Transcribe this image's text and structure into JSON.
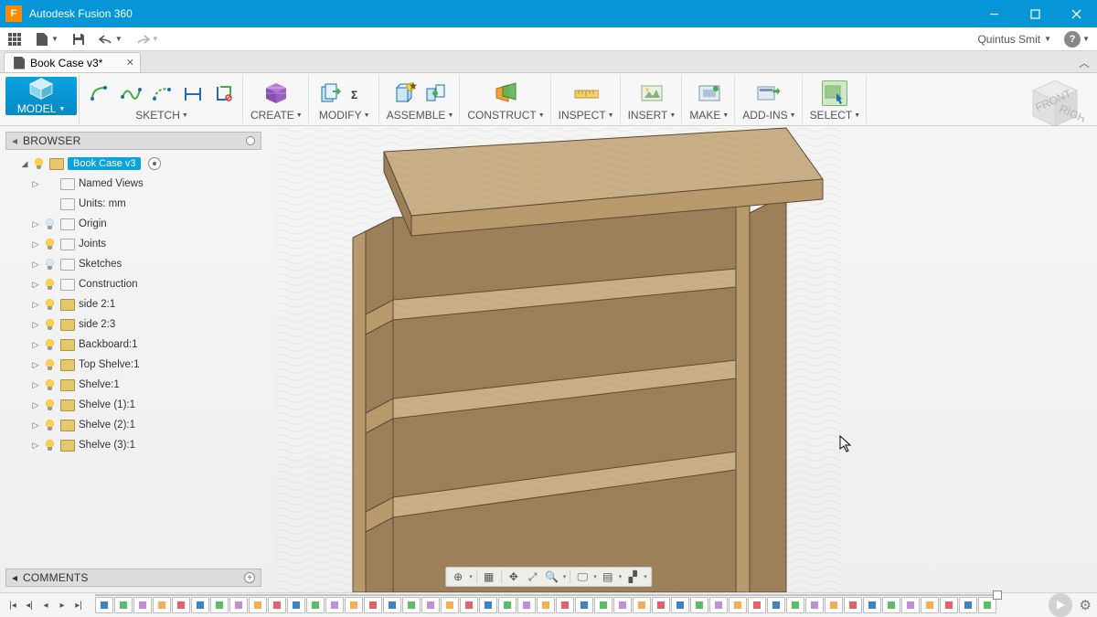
{
  "app": {
    "title": "Autodesk Fusion 360",
    "logo_letter": "F"
  },
  "user": {
    "name": "Quintus Smit"
  },
  "document": {
    "tab_title": "Book Case v3*"
  },
  "ribbon": {
    "model": "MODEL",
    "groups": {
      "sketch": "SKETCH",
      "create": "CREATE",
      "modify": "MODIFY",
      "assemble": "ASSEMBLE",
      "construct": "CONSTRUCT",
      "inspect": "INSPECT",
      "insert": "INSERT",
      "make": "MAKE",
      "addins": "ADD-INS",
      "select": "SELECT"
    }
  },
  "browser": {
    "header": "BROWSER",
    "root": "Book Case v3",
    "items": [
      {
        "label": "Named Views",
        "bulb": "none",
        "icon": "folder"
      },
      {
        "label": "Units: mm",
        "bulb": "none",
        "icon": "folder",
        "expandable": false
      },
      {
        "label": "Origin",
        "bulb": "off",
        "icon": "folder"
      },
      {
        "label": "Joints",
        "bulb": "on",
        "icon": "folder"
      },
      {
        "label": "Sketches",
        "bulb": "off",
        "icon": "folder"
      },
      {
        "label": "Construction",
        "bulb": "on",
        "icon": "folder"
      },
      {
        "label": "side 2:1",
        "bulb": "on",
        "icon": "comp"
      },
      {
        "label": "side 2:3",
        "bulb": "on",
        "icon": "comp"
      },
      {
        "label": "Backboard:1",
        "bulb": "on",
        "icon": "comp"
      },
      {
        "label": "Top Shelve:1",
        "bulb": "on",
        "icon": "comp"
      },
      {
        "label": "Shelve:1",
        "bulb": "on",
        "icon": "comp"
      },
      {
        "label": "Shelve (1):1",
        "bulb": "on",
        "icon": "comp"
      },
      {
        "label": "Shelve (2):1",
        "bulb": "on",
        "icon": "comp"
      },
      {
        "label": "Shelve (3):1",
        "bulb": "on",
        "icon": "comp"
      }
    ]
  },
  "comments": {
    "header": "COMMENTS"
  },
  "viewcube": {
    "front": "FRONT",
    "right": "RIGHT"
  },
  "timeline_item_count": 47
}
